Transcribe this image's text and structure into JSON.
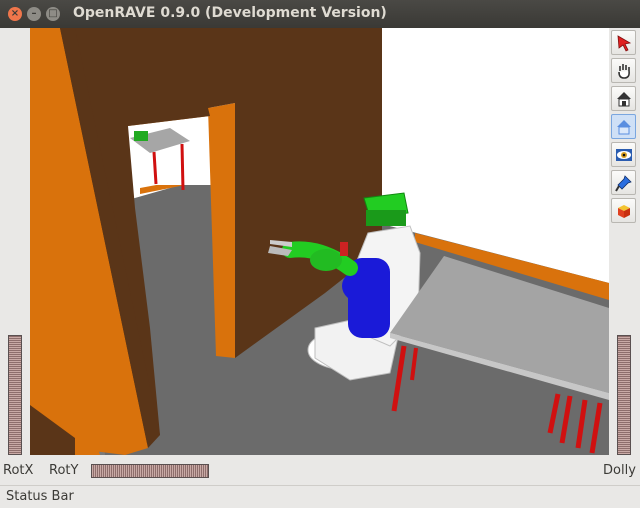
{
  "window": {
    "title": "OpenRAVE 0.9.0 (Development Version)",
    "close_glyph": "×",
    "min_glyph": "–",
    "max_glyph": "□"
  },
  "toolbar": {
    "tools": [
      {
        "name": "select-arrow-icon",
        "active": false
      },
      {
        "name": "pan-hand-icon",
        "active": false
      },
      {
        "name": "home-view-icon",
        "active": false
      },
      {
        "name": "set-home-icon",
        "active": true
      },
      {
        "name": "view-all-eye-icon",
        "active": false
      },
      {
        "name": "seek-flashlight-icon",
        "active": false
      },
      {
        "name": "perspective-cube-icon",
        "active": false
      }
    ]
  },
  "controls": {
    "rotx_label": "RotX",
    "roty_label": "RotY",
    "dolly_label": "Dolly"
  },
  "status": {
    "text": "Status Bar"
  },
  "colors": {
    "titlebar": "#3c3b37",
    "floor": "#6e6e6e",
    "wood": "#5a3518",
    "trim": "#d9720c",
    "robot_green": "#22cc22",
    "robot_blue": "#1a1ad8",
    "table_top": "#a4a4a4",
    "table_leg": "#d01010"
  }
}
